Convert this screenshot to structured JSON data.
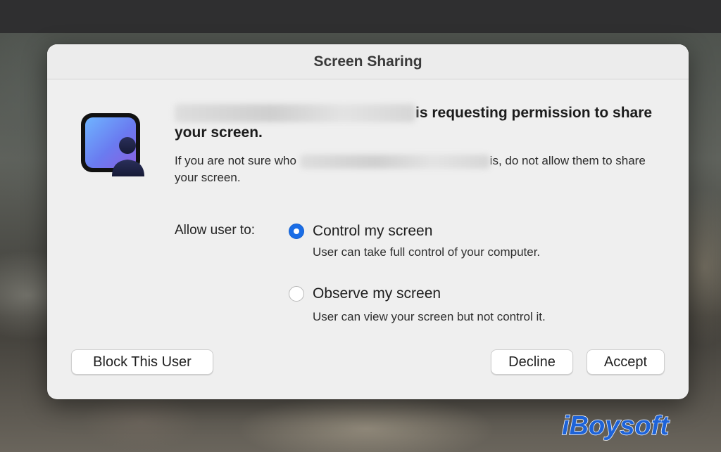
{
  "dialog": {
    "title": "Screen Sharing",
    "headline": "is requesting permission to share your screen.",
    "subtext_before": "If you are not sure who",
    "subtext_after": "is, do not allow them to share your screen.",
    "icon": "screen-sharing-app-icon"
  },
  "permissions": {
    "label": "Allow user to:",
    "options": [
      {
        "label": "Control my screen",
        "description": "User can take full control of your computer.",
        "selected": true
      },
      {
        "label": "Observe my screen",
        "description": "User can view your screen but not control it.",
        "selected": false
      }
    ]
  },
  "buttons": {
    "block": "Block This User",
    "decline": "Decline",
    "accept": "Accept"
  },
  "watermark": {
    "text": "iBoysoft"
  },
  "colors": {
    "accent": "#1a6de6",
    "dialog_bg": "#efefef",
    "top_bar": "#2f2f30"
  }
}
